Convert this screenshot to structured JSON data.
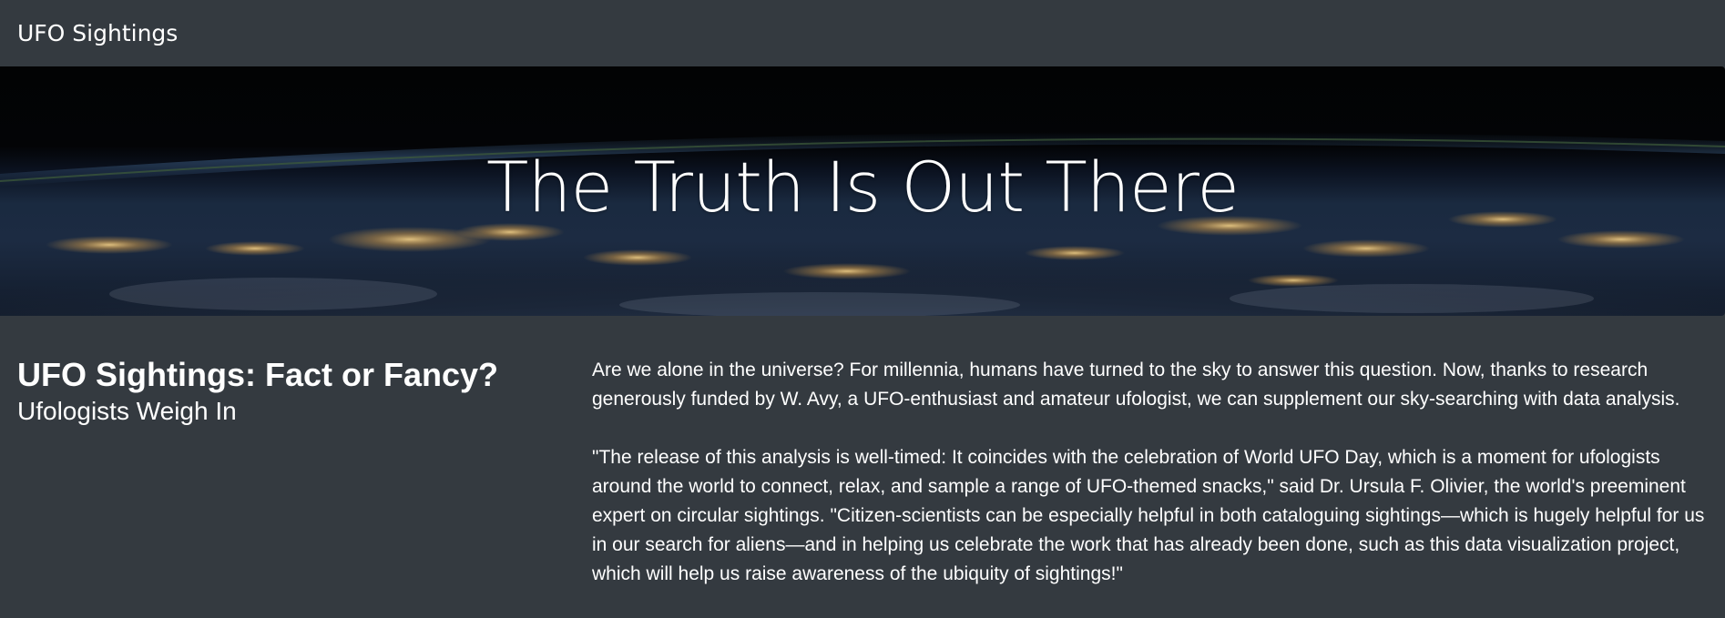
{
  "navbar": {
    "brand": "UFO Sightings"
  },
  "hero": {
    "title": "The Truth Is Out There"
  },
  "article": {
    "title": "UFO Sightings: Fact or Fancy?",
    "subtitle": "Ufologists Weigh In",
    "paragraphs": [
      "Are we alone in the universe? For millennia, humans have turned to the sky to answer this question. Now, thanks to research generously funded by W. Avy, a UFO-enthusiast and amateur ufologist, we can supplement our sky-searching with data analysis.",
      "\"The release of this analysis is well-timed: It coincides with the celebration of World UFO Day, which is a moment for ufologists around the world to connect, relax, and sample a range of UFO-themed snacks,\" said Dr. Ursula F. Olivier, the world's preeminent expert on circular sightings. \"Citizen-scientists can be especially helpful in both cataloguing sightings—which is hugely helpful for us in our search for aliens—and in helping us celebrate the work that has already been done, such as this data visualization project, which will help us raise awareness of the ubiquity of sightings!\""
    ]
  },
  "colors": {
    "background": "#343a40",
    "text": "#ffffff"
  }
}
